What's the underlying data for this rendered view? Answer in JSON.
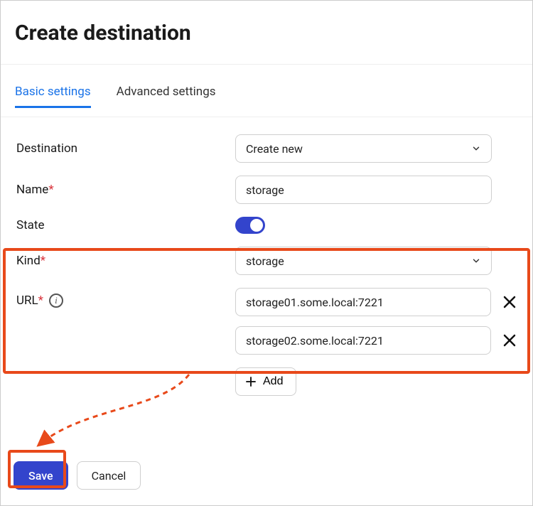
{
  "title": "Create destination",
  "tabs": {
    "basic": "Basic settings",
    "advanced": "Advanced settings"
  },
  "labels": {
    "destination": "Destination",
    "name": "Name",
    "state": "State",
    "kind": "Kind",
    "url": "URL"
  },
  "values": {
    "destination_selected": "Create new",
    "name": "storage",
    "state_on": true,
    "kind_selected": "storage",
    "urls": {
      "0": "storage01.some.local:7221",
      "1": "storage02.some.local:7221"
    }
  },
  "buttons": {
    "add": "Add",
    "save": "Save",
    "cancel": "Cancel"
  }
}
